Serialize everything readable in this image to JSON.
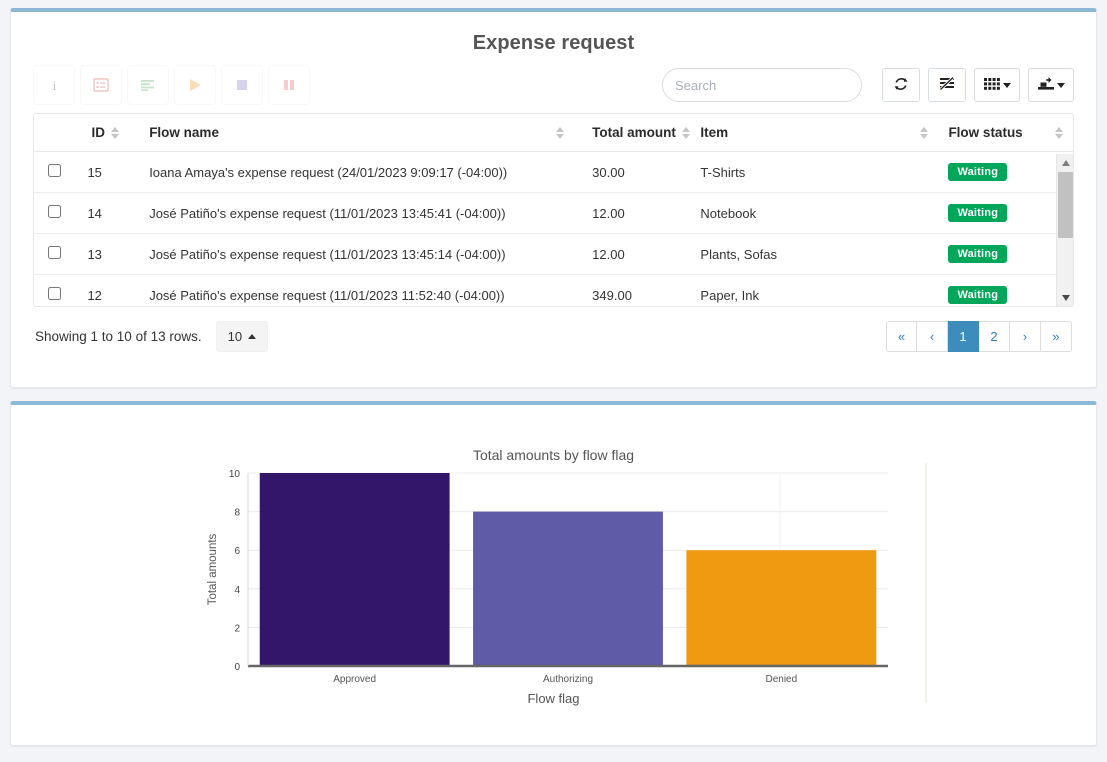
{
  "header": {
    "title": "Expense request"
  },
  "toolbar": {
    "left_buttons": [
      {
        "name": "info-button",
        "icon": "info-icon",
        "label": "Info"
      },
      {
        "name": "form-button",
        "icon": "form-list-icon",
        "label": "Form"
      },
      {
        "name": "lines-button",
        "icon": "lines-icon",
        "label": "Lines"
      },
      {
        "name": "play-button",
        "icon": "play-icon",
        "label": "Play"
      },
      {
        "name": "stop-button",
        "icon": "stop-icon",
        "label": "Stop"
      },
      {
        "name": "pause-button",
        "icon": "pause-icon",
        "label": "Pause"
      }
    ],
    "search": {
      "placeholder": "Search",
      "value": ""
    },
    "right_buttons": [
      {
        "name": "refresh-button",
        "icon": "refresh-icon",
        "label": "Refresh"
      },
      {
        "name": "toggle-button",
        "icon": "toggle-view-icon",
        "label": "Toggle"
      },
      {
        "name": "columns-button",
        "icon": "columns-grid-icon",
        "label": "Columns"
      },
      {
        "name": "export-button",
        "icon": "export-icon",
        "label": "Export"
      }
    ]
  },
  "table": {
    "columns": [
      {
        "key": "check",
        "label": ""
      },
      {
        "key": "id",
        "label": "ID"
      },
      {
        "key": "flow_name",
        "label": "Flow name"
      },
      {
        "key": "total_amount",
        "label": "Total amount"
      },
      {
        "key": "item",
        "label": "Item"
      },
      {
        "key": "flow_status",
        "label": "Flow status"
      }
    ],
    "rows": [
      {
        "id": "15",
        "flow_name": "Ioana Amaya's expense request (24/01/2023 9:09:17 (-04:00))",
        "total_amount": "30.00",
        "item": "T-Shirts",
        "flow_status": "Waiting",
        "checked": false
      },
      {
        "id": "14",
        "flow_name": "José Patiño's expense request (11/01/2023 13:45:41 (-04:00))",
        "total_amount": "12.00",
        "item": "Notebook",
        "flow_status": "Waiting",
        "checked": false
      },
      {
        "id": "13",
        "flow_name": "José Patiño's expense request (11/01/2023 13:45:14 (-04:00))",
        "total_amount": "12.00",
        "item": "Plants, Sofas",
        "flow_status": "Waiting",
        "checked": false
      },
      {
        "id": "12",
        "flow_name": "José Patiño's expense request (11/01/2023 11:52:40 (-04:00))",
        "total_amount": "349.00",
        "item": "Paper, Ink",
        "flow_status": "Waiting",
        "checked": false
      }
    ]
  },
  "footer": {
    "showing_text": "Showing 1 to 10 of 13 rows.",
    "page_size": "10",
    "pagination": [
      {
        "label": "«",
        "name": "pagination-first",
        "active": false
      },
      {
        "label": "‹",
        "name": "pagination-prev",
        "active": false
      },
      {
        "label": "1",
        "name": "pagination-page-1",
        "active": true
      },
      {
        "label": "2",
        "name": "pagination-page-2",
        "active": false
      },
      {
        "label": "›",
        "name": "pagination-next",
        "active": false
      },
      {
        "label": "»",
        "name": "pagination-last",
        "active": false
      }
    ]
  },
  "chart_data": {
    "type": "bar",
    "title": "Total amounts by flow flag",
    "xlabel": "Flow flag",
    "ylabel": "Total amounts",
    "categories": [
      "Approved",
      "Authorizing",
      "Denied"
    ],
    "values": [
      10,
      8,
      6
    ],
    "colors": [
      "#331569",
      "#5f5ba6",
      "#f09a12"
    ],
    "yticks": [
      0,
      2,
      4,
      6,
      8,
      10
    ],
    "ylim": [
      0,
      10
    ],
    "grid": true,
    "legend": "none"
  },
  "colors": {
    "card_accent": "#8bb8d4",
    "badge_green": "#00a65a",
    "pager_active": "#3c8dbc",
    "page_background": "#f2f4f7"
  }
}
